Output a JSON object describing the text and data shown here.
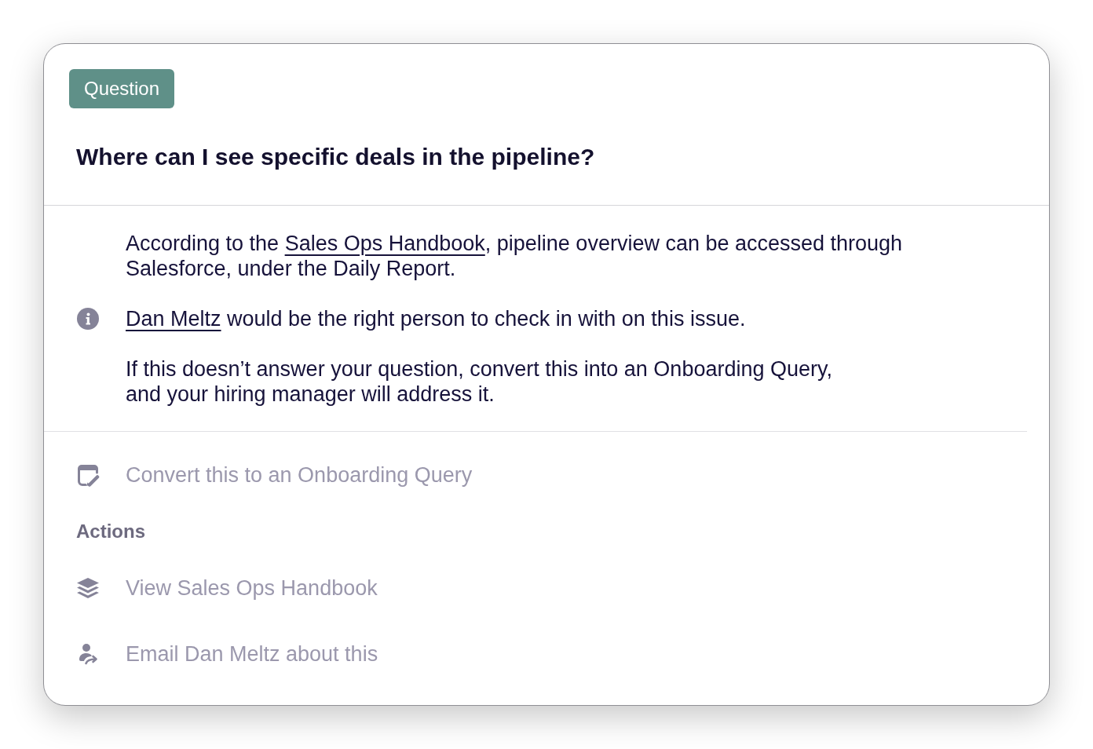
{
  "badge": {
    "label": "Question"
  },
  "question": "Where can I see specific deals in the pipeline?",
  "answer": {
    "paragraphs": [
      {
        "kind": "text",
        "parts": [
          {
            "kind": "text",
            "text": "According to the "
          },
          {
            "kind": "link",
            "text": "Sales Ops Handbook"
          },
          {
            "kind": "text",
            "text": ", pipeline overview can be accessed through\nSalesforce, under the Daily Report."
          }
        ]
      },
      {
        "kind": "note",
        "parts": [
          {
            "kind": "link",
            "text": "Dan Meltz"
          },
          {
            "kind": "text",
            "text": " would be the right person to check in with on this issue."
          }
        ]
      },
      {
        "kind": "text",
        "parts": [
          {
            "kind": "text",
            "text": "If this doesn’t answer your question, convert this into an Onboarding Query,\nand your hiring manager will address it."
          }
        ]
      }
    ]
  },
  "convert": {
    "kind": "convert",
    "label": "Convert this to an Onboarding Query"
  },
  "actions": {
    "heading": "Actions",
    "items": [
      {
        "kind": "handbook",
        "label": "View Sales Ops Handbook"
      },
      {
        "kind": "email",
        "label": "Email Dan Meltz about this"
      }
    ]
  }
}
